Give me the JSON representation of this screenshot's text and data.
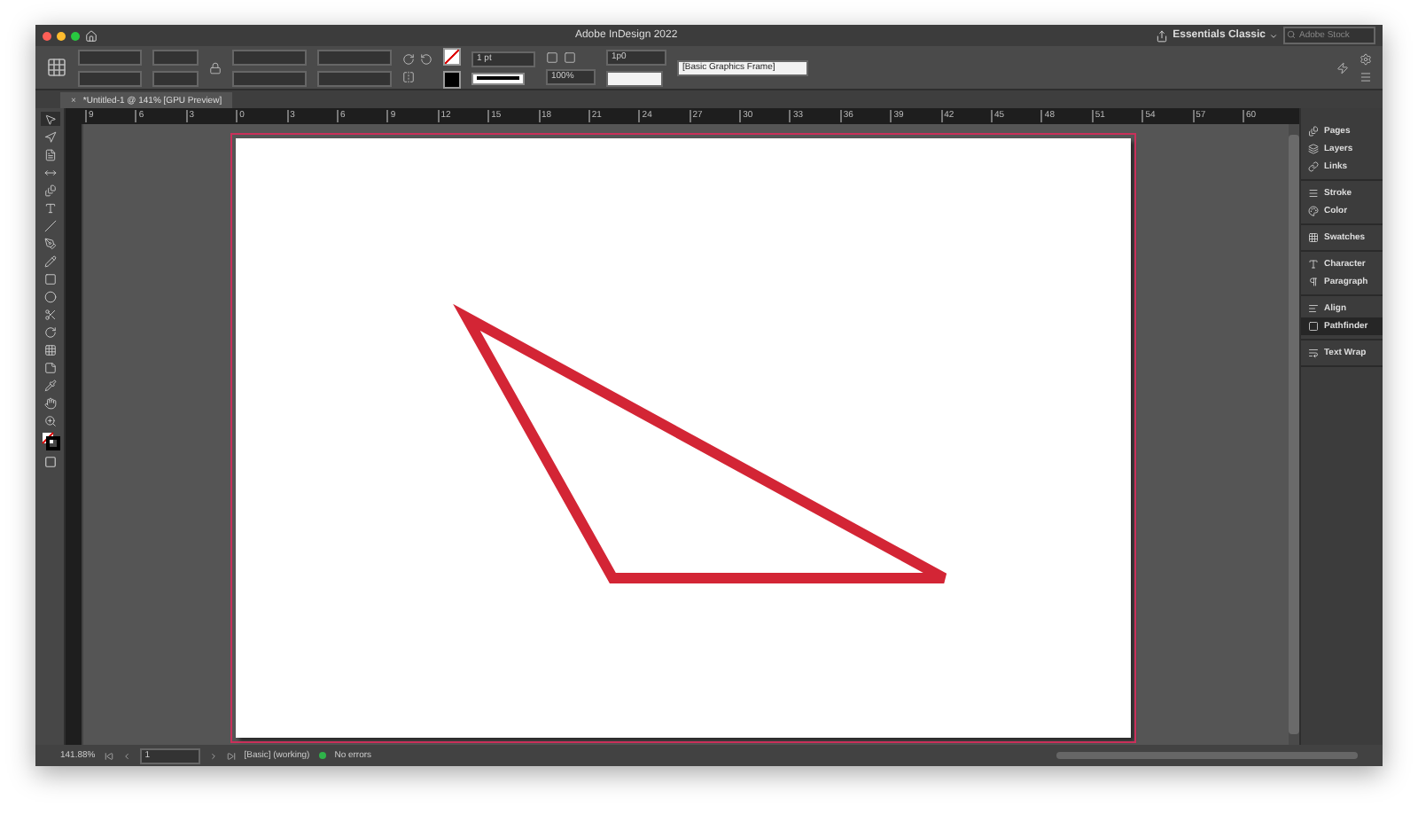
{
  "window": {
    "title": "Adobe InDesign 2022"
  },
  "header": {
    "workspace": "Essentials Classic",
    "search": {
      "placeholder": "Adobe Stock"
    }
  },
  "control_panel": {
    "stroke_weight": "1 pt",
    "scale": "100%",
    "offset": "1p0",
    "object_style": "[Basic Graphics Frame]"
  },
  "document_tab": {
    "title": "*Untitled-1 @ 141% [GPU Preview]",
    "close": "×"
  },
  "ruler": {
    "labels": [
      "9",
      "6",
      "3",
      "0",
      "3",
      "6",
      "9",
      "12",
      "15",
      "18",
      "21",
      "24",
      "27",
      "30",
      "33",
      "36",
      "39",
      "42",
      "45",
      "48",
      "51",
      "54",
      "57",
      "60"
    ]
  },
  "panels": [
    {
      "group": [
        {
          "label": "Pages",
          "selected": false
        },
        {
          "label": "Layers",
          "selected": false
        },
        {
          "label": "Links",
          "selected": false
        }
      ]
    },
    {
      "group": [
        {
          "label": "Stroke",
          "selected": false
        },
        {
          "label": "Color",
          "selected": false
        }
      ]
    },
    {
      "group": [
        {
          "label": "Swatches",
          "selected": false
        }
      ]
    },
    {
      "group": [
        {
          "label": "Character",
          "selected": false
        },
        {
          "label": "Paragraph",
          "selected": false
        }
      ]
    },
    {
      "group": [
        {
          "label": "Align",
          "selected": false
        },
        {
          "label": "Pathfinder",
          "selected": true
        }
      ]
    },
    {
      "group": [
        {
          "label": "Text Wrap",
          "selected": false
        }
      ]
    }
  ],
  "status_bar": {
    "zoom": "141.88%",
    "page": "1",
    "profile": "[Basic] (working)",
    "preflight": {
      "text": "No errors",
      "color": "#2fb34a"
    }
  }
}
